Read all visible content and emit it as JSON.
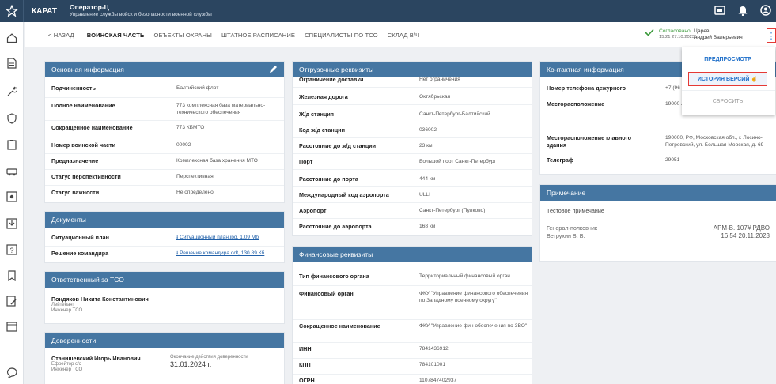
{
  "app": {
    "brand": "КАРАТ",
    "title": "Оператор-Ц",
    "subtitle": "Управление службы войск и безопасности военной службы"
  },
  "nav": {
    "back": "< НАЗАД",
    "tabs": [
      "ВОИНСКАЯ ЧАСТЬ",
      "ОБЪЕКТЫ ОХРАНЫ",
      "ШТАТНОЕ РАСПИСАНИЕ",
      "СПЕЦИАЛИСТЫ ПО ТСО",
      "СКЛАД В/Ч"
    ]
  },
  "status": {
    "label": "Согласовано",
    "date": "15:21 27.10.2023 г."
  },
  "user": {
    "last": "Царев",
    "first": "Андрей Валерьевич"
  },
  "menu": {
    "preview": "ПРЕДПРОСМОТР",
    "history": "ИСТОРИЯ ВЕРСИЙ",
    "reset": "СБРОСИТЬ"
  },
  "basic": {
    "title": "Основная информация",
    "rows": [
      {
        "k": "Подчиненность",
        "v": "Балтийский флот"
      },
      {
        "k": "Полное наименование",
        "v": "773 комплексная база материально-технического обеспечения"
      },
      {
        "k": "Сокращенное наименование",
        "v": "773 КБМТО"
      },
      {
        "k": "Номер воинской части",
        "v": "00002"
      },
      {
        "k": "Предназначение",
        "v": "Комплексная база хранения МТО"
      },
      {
        "k": "Статус перспективности",
        "v": "Перспективная"
      },
      {
        "k": "Статус важности",
        "v": "Не определено"
      }
    ]
  },
  "docs": {
    "title": "Документы",
    "rows": [
      {
        "k": "Ситуационный план",
        "v": "Ситуационный план.jpg, 1.09 Мб"
      },
      {
        "k": "Решение командира",
        "v": "Решение командира.odt, 130.89 Кб"
      }
    ]
  },
  "resp": {
    "title": "Ответственный за ТСО",
    "name": "Пондяков Никита Константинович",
    "rank": "Лейтенант",
    "role": "Инженер ТСО"
  },
  "trust": {
    "title": "Доверенности",
    "name": "Станишевский Игорь Иванович",
    "org": "Ефрейтор с/с",
    "role": "Инженер ТСО",
    "end_label": "Окончание действия доверенности",
    "end": "31.01.2024 г."
  },
  "ship": {
    "title": "Отгрузочные реквизиты",
    "rows": [
      {
        "k": "Ограничение доставки",
        "v": "Нет ограничения"
      },
      {
        "k": "Железная дорога",
        "v": "Октябрьская"
      },
      {
        "k": "Ж/д станция",
        "v": "Санкт-Петербург-Балтийский"
      },
      {
        "k": "Код ж/д станции",
        "v": "036002"
      },
      {
        "k": "Расстояние до ж/д станции",
        "v": "23 км"
      },
      {
        "k": "Порт",
        "v": "Большой порт Санкт-Петербург"
      },
      {
        "k": "Расстояние до порта",
        "v": "444 км"
      },
      {
        "k": "Международный код аэропорта",
        "v": "ULLI"
      },
      {
        "k": "Аэропорт",
        "v": "Санкт-Петербург (Пулково)"
      },
      {
        "k": "Расстояние до аэропорта",
        "v": "168 км"
      }
    ]
  },
  "fin": {
    "title": "Финансовые реквизиты",
    "rows": [
      {
        "k": "Тип финансового органа",
        "v": "Территориальный финансовый орган"
      },
      {
        "k": "Финансовый орган",
        "v": "ФКУ \"Управление финансового обеспечения по Западному военному округу\""
      },
      {
        "k": "Сокращенное наименование",
        "v": "ФКУ \"Управление фин обеспечения по ЗВО\""
      },
      {
        "k": "ИНН",
        "v": "7841436912"
      },
      {
        "k": "КПП",
        "v": "784101001"
      },
      {
        "k": "ОГРН",
        "v": "1107847402937"
      }
    ]
  },
  "contact": {
    "title": "Контактная информация",
    "rows": [
      {
        "k": "Номер телефона дежурного",
        "v": "+7 (96"
      },
      {
        "k": "Месторасположение",
        "v": "19000 Лосин Морская, д. 69"
      },
      {
        "k": "Месторасположение главного здания",
        "v": "190000, РФ, Московская обл., г. Лосино-Петровский, ул. Большая Морская, д. 69"
      },
      {
        "k": "Телеграф",
        "v": "29051"
      }
    ]
  },
  "note": {
    "title": "Примечание",
    "text": "Тестовое примечание",
    "rank": "Генерал-полковник",
    "name": "Ветрухин В. В.",
    "doc": "АРМ-В. 107# РДВО",
    "time": "16:54 20.11.2023"
  }
}
